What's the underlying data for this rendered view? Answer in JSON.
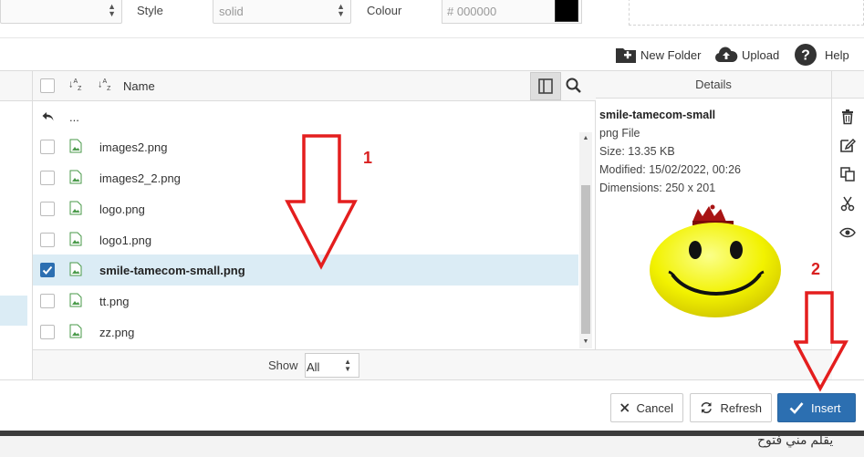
{
  "style_bar": {
    "style_label": "Style",
    "style_value": "solid",
    "colour_label": "Colour",
    "colour_value": "# 000000",
    "colour_swatch": "#000000"
  },
  "toolbar": {
    "new_folder": "New Folder",
    "upload": "Upload",
    "help": "Help"
  },
  "file_list": {
    "name_header": "Name",
    "up_entry": "...",
    "files": [
      {
        "name": "images2.png",
        "selected": false
      },
      {
        "name": "images2_2.png",
        "selected": false
      },
      {
        "name": "logo.png",
        "selected": false
      },
      {
        "name": "logo1.png",
        "selected": false
      },
      {
        "name": "smile-tamecom-small.png",
        "selected": true
      },
      {
        "name": "tt.png",
        "selected": false
      },
      {
        "name": "zz.png",
        "selected": false
      }
    ],
    "show_label": "Show",
    "show_value": "All"
  },
  "details": {
    "header": "Details",
    "title": "smile-tamecom-small",
    "type": "png File",
    "size": "Size: 13.35 KB",
    "modified": "Modified: 15/02/2022, 00:26",
    "dimensions": "Dimensions: 250 x 201"
  },
  "footer": {
    "cancel": "Cancel",
    "refresh": "Refresh",
    "insert": "Insert"
  },
  "annotations": {
    "num1": "1",
    "num2": "2"
  },
  "background_text": "يقلم مني فتوح",
  "colors": {
    "accent": "#2c6fb1",
    "selected_row": "#dbecf5",
    "annotation": "#d92020"
  }
}
